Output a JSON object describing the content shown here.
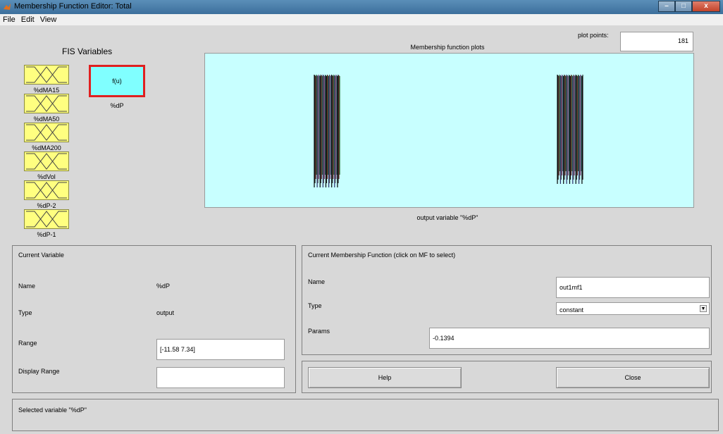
{
  "window": {
    "title": "Membership Function Editor: Total",
    "minimize": "–",
    "maximize": "□",
    "close": "x"
  },
  "menu": [
    "File",
    "Edit",
    "View"
  ],
  "fis": {
    "title": "FIS Variables",
    "inputs": [
      "%dMA15",
      "%dMA50",
      "%dMA200",
      "%dVol",
      "%dP-2",
      "%dP-1"
    ],
    "output": {
      "symbol": "f(u)",
      "name": "%dP"
    }
  },
  "plot": {
    "points_label": "plot points:",
    "points_value": "181",
    "title": "Membership function plots",
    "caption": "output variable \"%dP\""
  },
  "current_variable": {
    "title": "Current Variable",
    "name_label": "Name",
    "name_value": "%dP",
    "type_label": "Type",
    "type_value": "output",
    "range_label": "Range",
    "range_value": "[-11.58 7.34]",
    "display_range_label": "Display Range",
    "display_range_value": ""
  },
  "current_mf": {
    "title": "Current Membership Function (click on MF to select)",
    "name_label": "Name",
    "name_value": "out1mf1",
    "type_label": "Type",
    "type_value": "constant",
    "params_label": "Params",
    "params_value": "-0.1394"
  },
  "buttons": {
    "help": "Help",
    "close": "Close"
  },
  "status": "Selected variable \"%dP\"",
  "colors": {
    "input_mf": "#ffff80",
    "output_box": "#80ffff",
    "plot_bg": "#c8ffff",
    "selected_border": "#e02020"
  }
}
